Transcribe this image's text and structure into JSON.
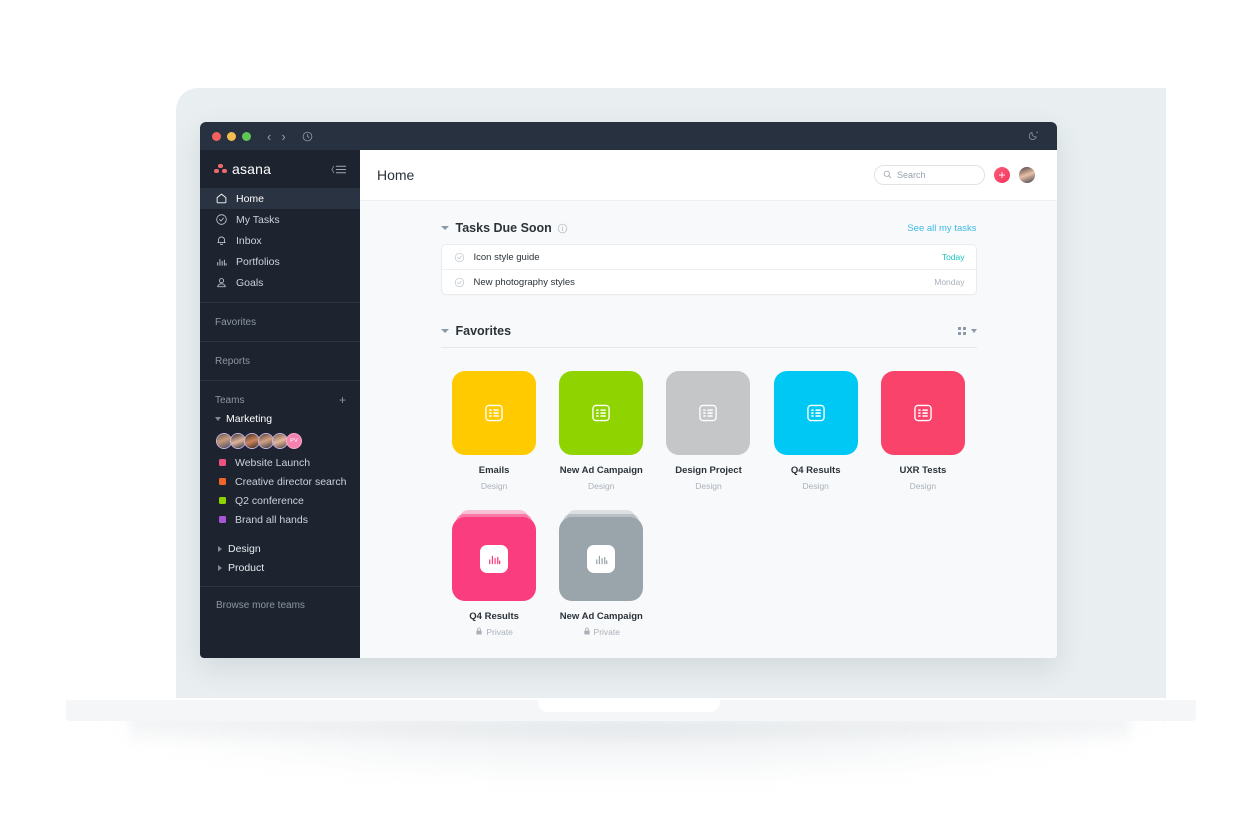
{
  "titlebar": {
    "traffic_lights": [
      "close",
      "minimize",
      "maximize"
    ],
    "back_label": "‹",
    "forward_label": "›",
    "history_icon": "clock-icon",
    "theme_icon": "moon-icon"
  },
  "sidebar": {
    "brand": "asana",
    "collapse_icon": "collapse-sidebar-icon",
    "nav": [
      {
        "label": "Home",
        "icon": "home-icon",
        "active": true
      },
      {
        "label": "My Tasks",
        "icon": "check-circle-icon",
        "active": false
      },
      {
        "label": "Inbox",
        "icon": "bell-icon",
        "active": false
      },
      {
        "label": "Portfolios",
        "icon": "bar-chart-icon",
        "active": false
      },
      {
        "label": "Goals",
        "icon": "goal-icon",
        "active": false
      }
    ],
    "favorites_label": "Favorites",
    "reports_label": "Reports",
    "teams_label": "Teams",
    "add_team_label": "+",
    "team_name": "Marketing",
    "members": [
      {
        "type": "photo",
        "name": "member-1"
      },
      {
        "type": "photo",
        "name": "member-2"
      },
      {
        "type": "photo",
        "name": "member-3"
      },
      {
        "type": "photo",
        "name": "member-4"
      },
      {
        "type": "photo",
        "name": "member-5"
      },
      {
        "type": "initials",
        "name": "member-6",
        "initials": "PV"
      }
    ],
    "projects": [
      {
        "label": "Website Launch",
        "color": "#f0507e"
      },
      {
        "label": "Creative director search",
        "color": "#f2642a"
      },
      {
        "label": "Q2 conference",
        "color": "#8fd400"
      },
      {
        "label": "Brand all hands",
        "color": "#a855d8"
      }
    ],
    "collapsed_teams": [
      {
        "label": "Design"
      },
      {
        "label": "Product"
      }
    ],
    "browse_more": "Browse more teams"
  },
  "topbar": {
    "title": "Home",
    "search_placeholder": "Search",
    "search_value": "",
    "add_label": "+",
    "avatar": "user-avatar"
  },
  "tasks_section": {
    "title": "Tasks Due Soon",
    "info_icon": "info-icon",
    "see_all": "See all my tasks",
    "rows": [
      {
        "name": "Icon style guide",
        "due": "Today",
        "due_style": "today"
      },
      {
        "name": "New photography styles",
        "due": "Monday",
        "due_style": "other"
      }
    ]
  },
  "favorites_section": {
    "title": "Favorites",
    "view_toggle_icon": "grid-view-icon",
    "row1": [
      {
        "title": "Emails",
        "subtitle": "Design",
        "color": "#ffcb00",
        "icon": "list-icon"
      },
      {
        "title": "New Ad Campaign",
        "subtitle": "Design",
        "color": "#8fd400",
        "icon": "list-icon"
      },
      {
        "title": "Design Project",
        "subtitle": "Design",
        "color": "#c4c6c8",
        "icon": "list-icon"
      },
      {
        "title": "Q4 Results",
        "subtitle": "Design",
        "color": "#00c8f5",
        "icon": "list-icon"
      },
      {
        "title": "UXR Tests",
        "subtitle": "Design",
        "color": "#f9436b",
        "icon": "list-icon"
      }
    ],
    "row2": [
      {
        "title": "Q4 Results",
        "subtitle": "Private",
        "color": "#fa3d7e",
        "icon": "portfolio-chart-icon",
        "lock": true
      },
      {
        "title": "New Ad Campaign",
        "subtitle": "Private",
        "color": "#9aa5ab",
        "icon": "portfolio-chart-icon",
        "lock": true
      }
    ]
  },
  "colors": {
    "sidebar_bg": "#1d2430",
    "titlebar_bg": "#27313f",
    "content_bg": "#f8f9fa",
    "accent_link": "#3fb9e5",
    "accent_today": "#1cc6c0",
    "add_button": "#f4365b",
    "laptop_body": "#e9eff0"
  }
}
